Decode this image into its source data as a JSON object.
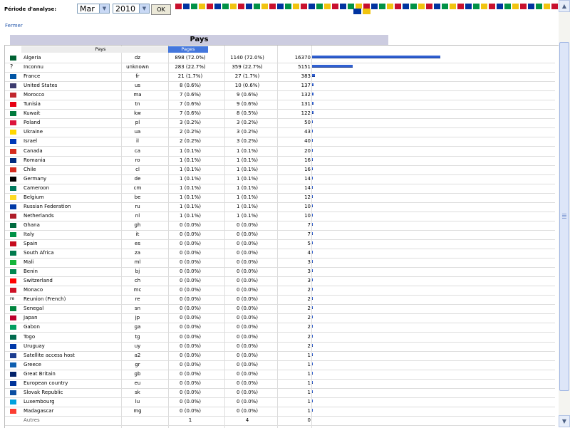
{
  "toolbar": {
    "period_label": "Période d'analyse:",
    "month": "Mar",
    "year": "2010",
    "ok_label": "OK"
  },
  "close_link": "Fermer",
  "panel": {
    "title": "Pays",
    "col_pays": "Pays",
    "col_pages": "Pages"
  },
  "rows": [
    {
      "name": "Algeria",
      "code": "dz",
      "pages": "898 (72.0%)",
      "hits": "1140 (72.0%)",
      "bw": "16370",
      "pct": 1.0,
      "flag": "#006233"
    },
    {
      "name": "Inconnu",
      "code": "unknown",
      "pages": "283 (22.7%)",
      "hits": "359 (22.7%)",
      "bw": "5151",
      "pct": 0.315,
      "flag": "none"
    },
    {
      "name": "France",
      "code": "fr",
      "pages": "21 (1.7%)",
      "hits": "27 (1.7%)",
      "bw": "383",
      "pct": 0.023,
      "flag": "#0055a4"
    },
    {
      "name": "United States",
      "code": "us",
      "pages": "8 (0.6%)",
      "hits": "10 (0.6%)",
      "bw": "137",
      "pct": 0.012,
      "flag": "#3c3b6e"
    },
    {
      "name": "Morocco",
      "code": "ma",
      "pages": "7 (0.6%)",
      "hits": "9 (0.6%)",
      "bw": "132",
      "pct": 0.012,
      "flag": "#c1272d"
    },
    {
      "name": "Tunisia",
      "code": "tn",
      "pages": "7 (0.6%)",
      "hits": "9 (0.6%)",
      "bw": "131",
      "pct": 0.012,
      "flag": "#e70013"
    },
    {
      "name": "Kuwait",
      "code": "kw",
      "pages": "7 (0.6%)",
      "hits": "8 (0.5%)",
      "bw": "122",
      "pct": 0.01,
      "flag": "#007a3d"
    },
    {
      "name": "Poland",
      "code": "pl",
      "pages": "3 (0.2%)",
      "hits": "3 (0.2%)",
      "bw": "50",
      "pct": 0.004,
      "flag": "#dc143c"
    },
    {
      "name": "Ukraine",
      "code": "ua",
      "pages": "2 (0.2%)",
      "hits": "3 (0.2%)",
      "bw": "43",
      "pct": 0.004,
      "flag": "#ffd700"
    },
    {
      "name": "Israel",
      "code": "il",
      "pages": "2 (0.2%)",
      "hits": "3 (0.2%)",
      "bw": "40",
      "pct": 0.004,
      "flag": "#0038b8"
    },
    {
      "name": "Canada",
      "code": "ca",
      "pages": "1 (0.1%)",
      "hits": "1 (0.1%)",
      "bw": "20",
      "pct": 0.002,
      "flag": "#d52b1e"
    },
    {
      "name": "Romania",
      "code": "ro",
      "pages": "1 (0.1%)",
      "hits": "1 (0.1%)",
      "bw": "16",
      "pct": 0.002,
      "flag": "#002b7f"
    },
    {
      "name": "Chile",
      "code": "cl",
      "pages": "1 (0.1%)",
      "hits": "1 (0.1%)",
      "bw": "16",
      "pct": 0.002,
      "flag": "#d52b1e"
    },
    {
      "name": "Germany",
      "code": "de",
      "pages": "1 (0.1%)",
      "hits": "1 (0.1%)",
      "bw": "14",
      "pct": 0.002,
      "flag": "#000000"
    },
    {
      "name": "Cameroon",
      "code": "cm",
      "pages": "1 (0.1%)",
      "hits": "1 (0.1%)",
      "bw": "14",
      "pct": 0.002,
      "flag": "#007a5e"
    },
    {
      "name": "Belgium",
      "code": "be",
      "pages": "1 (0.1%)",
      "hits": "1 (0.1%)",
      "bw": "12",
      "pct": 0.002,
      "flag": "#fdda24"
    },
    {
      "name": "Russian Federation",
      "code": "ru",
      "pages": "1 (0.1%)",
      "hits": "1 (0.1%)",
      "bw": "10",
      "pct": 0.002,
      "flag": "#0039a6"
    },
    {
      "name": "Netherlands",
      "code": "nl",
      "pages": "1 (0.1%)",
      "hits": "1 (0.1%)",
      "bw": "10",
      "pct": 0.002,
      "flag": "#ae1c28"
    },
    {
      "name": "Ghana",
      "code": "gh",
      "pages": "0 (0.0%)",
      "hits": "0 (0.0%)",
      "bw": "7",
      "pct": 0.001,
      "flag": "#006b3f"
    },
    {
      "name": "Italy",
      "code": "it",
      "pages": "0 (0.0%)",
      "hits": "0 (0.0%)",
      "bw": "7",
      "pct": 0.001,
      "flag": "#009246"
    },
    {
      "name": "Spain",
      "code": "es",
      "pages": "0 (0.0%)",
      "hits": "0 (0.0%)",
      "bw": "5",
      "pct": 0.001,
      "flag": "#c60b1e"
    },
    {
      "name": "South Africa",
      "code": "za",
      "pages": "0 (0.0%)",
      "hits": "0 (0.0%)",
      "bw": "4",
      "pct": 0.001,
      "flag": "#007a4d"
    },
    {
      "name": "Mali",
      "code": "ml",
      "pages": "0 (0.0%)",
      "hits": "0 (0.0%)",
      "bw": "3",
      "pct": 0.001,
      "flag": "#14b53a"
    },
    {
      "name": "Benin",
      "code": "bj",
      "pages": "0 (0.0%)",
      "hits": "0 (0.0%)",
      "bw": "3",
      "pct": 0.001,
      "flag": "#008751"
    },
    {
      "name": "Switzerland",
      "code": "ch",
      "pages": "0 (0.0%)",
      "hits": "0 (0.0%)",
      "bw": "3",
      "pct": 0.001,
      "flag": "#ff0000"
    },
    {
      "name": "Monaco",
      "code": "mc",
      "pages": "0 (0.0%)",
      "hits": "0 (0.0%)",
      "bw": "2",
      "pct": 0.001,
      "flag": "#ce1126"
    },
    {
      "name": "Reunion (French)",
      "code": "re",
      "pages": "0 (0.0%)",
      "hits": "0 (0.0%)",
      "bw": "2",
      "pct": 0.001,
      "flag": "re"
    },
    {
      "name": "Senegal",
      "code": "sn",
      "pages": "0 (0.0%)",
      "hits": "0 (0.0%)",
      "bw": "2",
      "pct": 0.001,
      "flag": "#00853f"
    },
    {
      "name": "Japan",
      "code": "jp",
      "pages": "0 (0.0%)",
      "hits": "0 (0.0%)",
      "bw": "2",
      "pct": 0.001,
      "flag": "#bc002d"
    },
    {
      "name": "Gabon",
      "code": "ga",
      "pages": "0 (0.0%)",
      "hits": "0 (0.0%)",
      "bw": "2",
      "pct": 0.001,
      "flag": "#009e60"
    },
    {
      "name": "Togo",
      "code": "tg",
      "pages": "0 (0.0%)",
      "hits": "0 (0.0%)",
      "bw": "2",
      "pct": 0.001,
      "flag": "#006a4e"
    },
    {
      "name": "Uruguay",
      "code": "uy",
      "pages": "0 (0.0%)",
      "hits": "0 (0.0%)",
      "bw": "2",
      "pct": 0.001,
      "flag": "#0038a8"
    },
    {
      "name": "Satellite access host",
      "code": "a2",
      "pages": "0 (0.0%)",
      "hits": "0 (0.0%)",
      "bw": "1",
      "pct": 0.001,
      "flag": "#1a3b8f"
    },
    {
      "name": "Greece",
      "code": "gr",
      "pages": "0 (0.0%)",
      "hits": "0 (0.0%)",
      "bw": "1",
      "pct": 0.001,
      "flag": "#0d5eaf"
    },
    {
      "name": "Great Britain",
      "code": "gb",
      "pages": "0 (0.0%)",
      "hits": "0 (0.0%)",
      "bw": "1",
      "pct": 0.001,
      "flag": "#012169"
    },
    {
      "name": "European country",
      "code": "eu",
      "pages": "0 (0.0%)",
      "hits": "0 (0.0%)",
      "bw": "1",
      "pct": 0.001,
      "flag": "#003399"
    },
    {
      "name": "Slovak Republic",
      "code": "sk",
      "pages": "0 (0.0%)",
      "hits": "0 (0.0%)",
      "bw": "1",
      "pct": 0.001,
      "flag": "#0b4ea2"
    },
    {
      "name": "Luxembourg",
      "code": "lu",
      "pages": "0 (0.0%)",
      "hits": "0 (0.0%)",
      "bw": "1",
      "pct": 0.001,
      "flag": "#00a1de"
    },
    {
      "name": "Madagascar",
      "code": "mg",
      "pages": "0 (0.0%)",
      "hits": "0 (0.0%)",
      "bw": "1",
      "pct": 0.001,
      "flag": "#fc3d32"
    }
  ],
  "others": {
    "name": "Autres",
    "pages": "1",
    "hits": "4",
    "bw": "0"
  },
  "colors": {
    "accent": "#4477dd",
    "bar": "#2f5fd1",
    "title_bg": "#cccce0"
  }
}
